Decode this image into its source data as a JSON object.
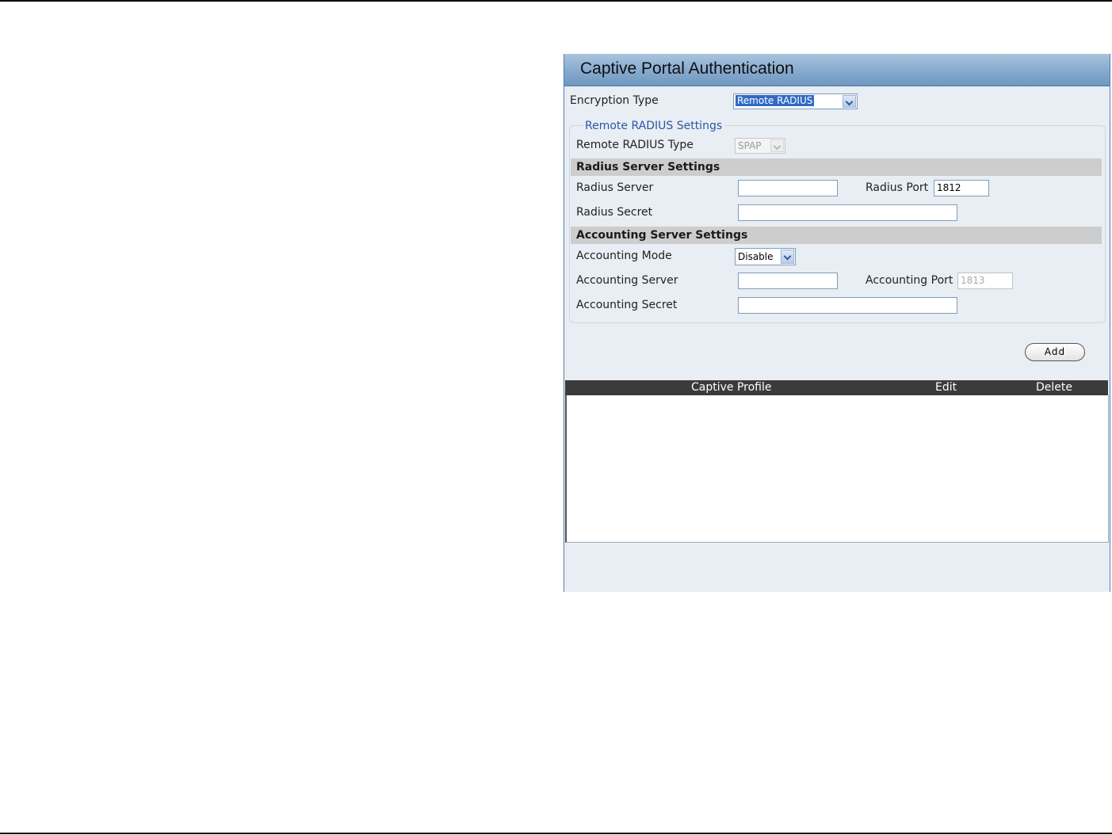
{
  "panel": {
    "title": "Captive Portal Authentication"
  },
  "encryption": {
    "label": "Encryption Type",
    "value": "Remote RADIUS"
  },
  "remote_radius": {
    "legend": "Remote RADIUS Settings",
    "type_label": "Remote RADIUS Type",
    "type_value": "SPAP"
  },
  "radius_server_settings": {
    "heading": "Radius Server Settings",
    "server_label": "Radius Server",
    "server_value": "",
    "port_label": "Radius Port",
    "port_value": "1812",
    "secret_label": "Radius Secret",
    "secret_value": ""
  },
  "accounting_server_settings": {
    "heading": "Accounting Server Settings",
    "mode_label": "Accounting Mode",
    "mode_value": "Disable",
    "server_label": "Accounting Server",
    "server_value": "",
    "port_label": "Accounting Port",
    "port_value": "1813",
    "secret_label": "Accounting Secret",
    "secret_value": ""
  },
  "actions": {
    "add_label": "Add"
  },
  "table": {
    "columns": [
      "Captive Profile",
      "Edit",
      "Delete"
    ],
    "rows": []
  },
  "colors": {
    "header_gradient_top": "#a9c4de",
    "header_gradient_bottom": "#6f97c0",
    "panel_bg": "#e8eef3",
    "section_bar": "#cdcdcd",
    "table_header": "#3b3b3b",
    "legend_text": "#2c56a8"
  }
}
